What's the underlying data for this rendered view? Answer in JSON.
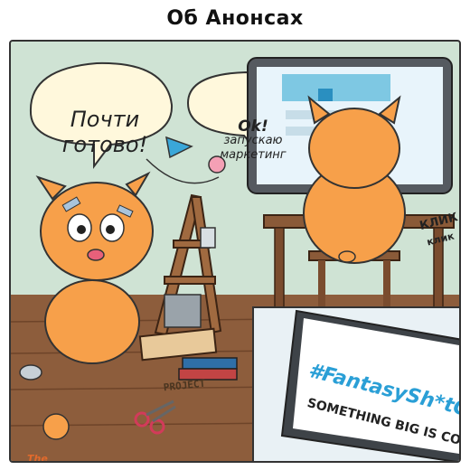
{
  "title": "Об Анонсах",
  "bubble_left": "Почти готово!",
  "bubble_right_line1": "Ok!",
  "bubble_right_line2": "запускаю маркетинг",
  "click_1": "КЛИК",
  "click_2": "клик",
  "project_sign": "PROJECT",
  "tv_line1": "#FantasySh*tCoin",
  "tv_line2": "SOMETHING BIG IS COMING",
  "logo_text": "The Cheeky Cheeks",
  "colors": {
    "cat": "#f7a04a",
    "wall": "#cfe3d4",
    "floor": "#8a5a3a",
    "accent": "#2a9fd6"
  }
}
